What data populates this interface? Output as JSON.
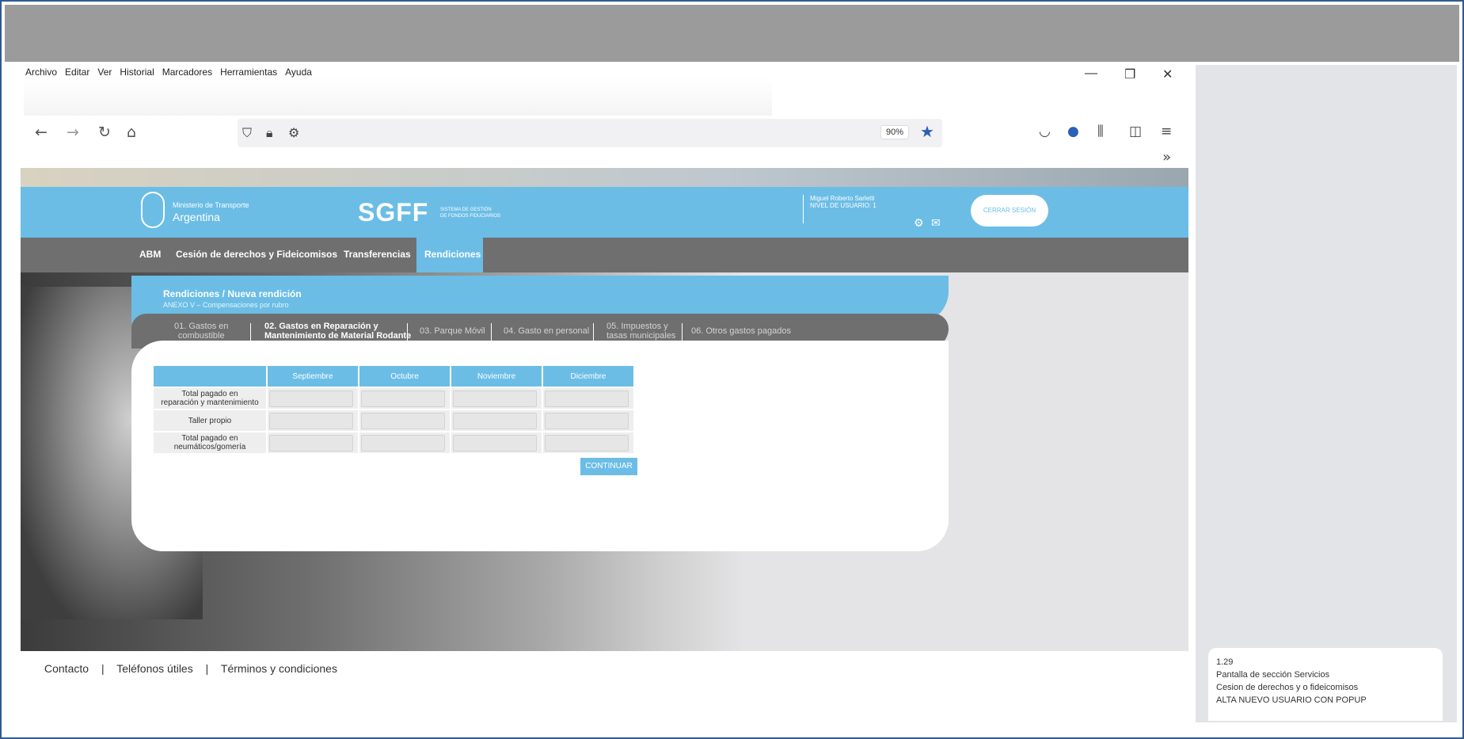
{
  "browser": {
    "menu": [
      "Archivo",
      "Editar",
      "Ver",
      "Historial",
      "Marcadores",
      "Herramientas",
      "Ayuda"
    ],
    "zoom": "90%"
  },
  "site": {
    "ministry_small": "Ministerio de Transporte",
    "ministry_big": "Argentina",
    "app_name": "SGFF",
    "app_sub1": "SISTEMA DE GESTIÓN",
    "app_sub2": "DE FONDOS FIDUCIARIOS",
    "user_name": "Miguel Roberto Sarletti",
    "user_level": "NIVEL DE USUARIO: 1",
    "logout": "CERRAR SESIÓN",
    "nav": [
      "ABM",
      "Cesión de derechos y Fideicomisos",
      "Transferencias",
      "Rendiciones"
    ]
  },
  "card": {
    "title": "Rendiciones / Nueva rendición",
    "subtitle": "ANEXO V – Compensaciones por rubro",
    "tabs": [
      {
        "line1": "01. Gastos en",
        "line2": "combustible"
      },
      {
        "line1": "02. Gastos en Reparación y",
        "line2": "Mantenimiento de Material Rodante"
      },
      {
        "line1": "03. Parque Móvil",
        "line2": ""
      },
      {
        "line1": "04. Gasto en personal",
        "line2": ""
      },
      {
        "line1": "05. Impuestos y",
        "line2": "tasas municipales"
      },
      {
        "line1": "06. Otros gastos pagados",
        "line2": ""
      }
    ],
    "columns": [
      "Septiembre",
      "Octubre",
      "Noviembre",
      "Diciembre"
    ],
    "rows": [
      {
        "line1": "Total pagado en",
        "line2": "reparación y mantenimiento"
      },
      {
        "line1": "Taller propio",
        "line2": ""
      },
      {
        "line1": "Total pagado en",
        "line2": "neumáticos/gomería"
      }
    ],
    "continue_button": "CONTINUAR"
  },
  "footer": {
    "contact": "Contacto",
    "sep": "|",
    "phones": "Teléfonos útiles",
    "terms": "Términos y condiciones"
  },
  "note": {
    "number": "1.29",
    "line1": "Pantalla de sección Servicios",
    "line2": "Cesion de derechos y o fideicomisos",
    "line3": "ALTA NUEVO USUARIO CON POPUP"
  }
}
